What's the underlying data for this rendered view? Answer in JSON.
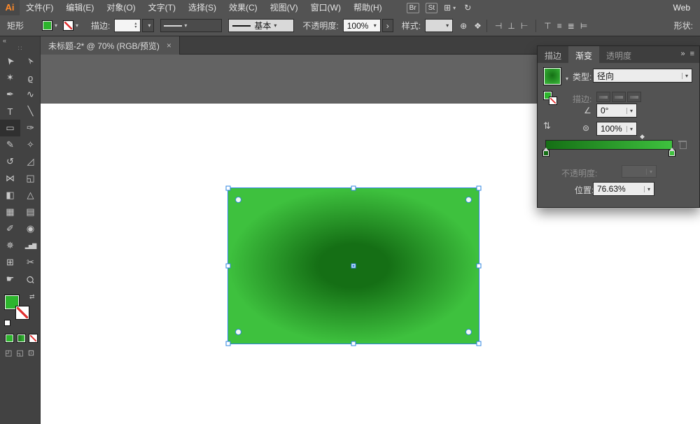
{
  "colors": {
    "accent_blue": "#2f84e0",
    "gradient_center": "#156f15",
    "gradient_edge": "#3ec13e",
    "fill_green": "#2db52d",
    "none_red": "#e03030"
  },
  "menu_bar": {
    "logo": "Ai",
    "items": [
      {
        "label": "文件(F)"
      },
      {
        "label": "编辑(E)"
      },
      {
        "label": "对象(O)"
      },
      {
        "label": "文字(T)"
      },
      {
        "label": "选择(S)"
      },
      {
        "label": "效果(C)"
      },
      {
        "label": "视图(V)"
      },
      {
        "label": "窗口(W)"
      },
      {
        "label": "帮助(H)"
      }
    ],
    "bridge_label": "Br",
    "stock_label": "St",
    "workspace_label": "Web"
  },
  "control_bar": {
    "context_label": "矩形",
    "stroke_label": "描边:",
    "brush_value": "基本",
    "opacity_label": "不透明度:",
    "opacity_value": "100%",
    "options_button": "›",
    "style_label": "样式:",
    "shape_label": "形状:",
    "align_icons": [
      "⊣",
      "⊥",
      "⊢",
      "⊤",
      "≡",
      "≣",
      "⊨"
    ]
  },
  "document_tab": {
    "title": "未标题-2* @ 70% (RGB/预览)",
    "close_label": "×"
  },
  "toolbar": {
    "collapse_label": "«",
    "grip_glyph": "∷",
    "tools": [
      {
        "name": "selection-tool",
        "glyph": "➤"
      },
      {
        "name": "direct-selection-tool",
        "glyph": "➢"
      },
      {
        "name": "magic-wand-tool",
        "glyph": "✶"
      },
      {
        "name": "lasso-tool",
        "glyph": "ϱ"
      },
      {
        "name": "pen-tool",
        "glyph": "✒"
      },
      {
        "name": "curvature-tool",
        "glyph": "∿"
      },
      {
        "name": "type-tool",
        "glyph": "T"
      },
      {
        "name": "line-segment-tool",
        "glyph": "╲"
      },
      {
        "name": "rectangle-tool",
        "glyph": "▭"
      },
      {
        "name": "paintbrush-tool",
        "glyph": "✑"
      },
      {
        "name": "pencil-tool",
        "glyph": "✎"
      },
      {
        "name": "shaper-tool",
        "glyph": "✧"
      },
      {
        "name": "rotate-tool",
        "glyph": "↺"
      },
      {
        "name": "scale-tool",
        "glyph": "◿"
      },
      {
        "name": "width-tool",
        "glyph": "⋈"
      },
      {
        "name": "free-transform-tool",
        "glyph": "◱"
      },
      {
        "name": "shape-builder-tool",
        "glyph": "◧"
      },
      {
        "name": "perspective-grid-tool",
        "glyph": "△"
      },
      {
        "name": "mesh-tool",
        "glyph": "▦"
      },
      {
        "name": "gradient-tool",
        "glyph": "▤"
      },
      {
        "name": "eyedropper-tool",
        "glyph": "✐"
      },
      {
        "name": "blend-tool",
        "glyph": "◉"
      },
      {
        "name": "symbol-sprayer-tool",
        "glyph": "✵"
      },
      {
        "name": "column-graph-tool",
        "glyph": "▂▅▇"
      },
      {
        "name": "artboard-tool",
        "glyph": "⊞"
      },
      {
        "name": "slice-tool",
        "glyph": "✂"
      },
      {
        "name": "hand-tool",
        "glyph": "☛"
      },
      {
        "name": "zoom-tool",
        "glyph": "Ϙ"
      }
    ]
  },
  "icons": {
    "angle": "∠",
    "aspect": "⊜",
    "reverse": "⇅",
    "globe": "⊕",
    "recolor": "❖",
    "swap": "⇄",
    "arrange": "⊞",
    "sync": "↻",
    "mode_normal": "◰",
    "mode_behind": "◱",
    "screen_mode": "⊡",
    "panel_collapse": "»",
    "panel_menu": "≡"
  },
  "gradient_panel": {
    "tabs": [
      {
        "label": "描边",
        "active": false
      },
      {
        "label": "渐变",
        "active": true
      },
      {
        "label": "透明度",
        "active": false
      }
    ],
    "type_label": "类型:",
    "type_value": "径向",
    "stroke_label": "描边:",
    "angle_value": "0°",
    "aspect_value": "100%",
    "opacity_label": "不透明度:",
    "position_label": "位置:",
    "position_value": "76.63%",
    "midpoint_percent": 76.63
  }
}
